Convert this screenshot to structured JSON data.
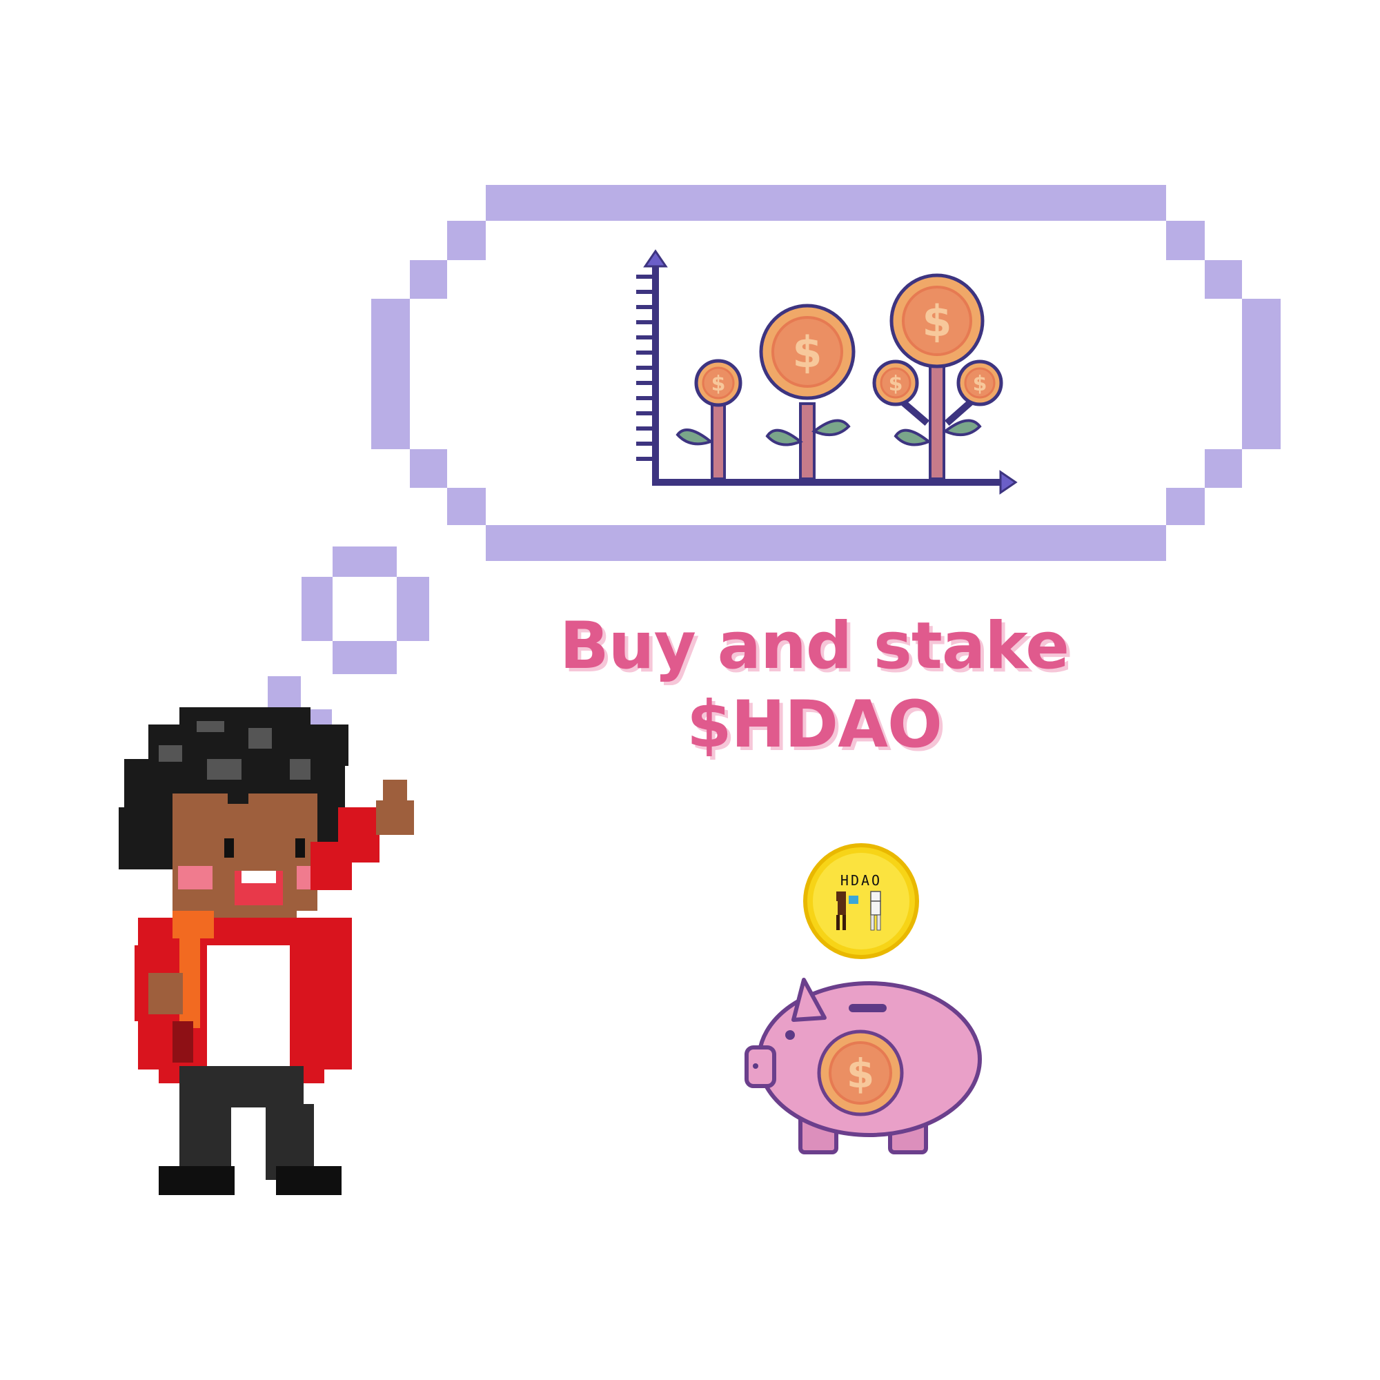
{
  "headline": {
    "line1": "Buy and stake",
    "line2": "$HDAO",
    "color": "#e05a8d"
  },
  "coin": {
    "text": "HDAO",
    "icon": "hdao-coin-icon"
  },
  "icons": {
    "bubble": "thought-bubble-icon",
    "growth": "money-tree-growth-chart-icon",
    "character": "pixel-boy-character",
    "piggy": "piggy-bank-icon"
  },
  "colors": {
    "bubble": "#b9aee6",
    "coin_orange": "#f0a868",
    "coin_yellow": "#f7d417",
    "piggy_pink": "#e9a0c8",
    "jacket_red": "#d9141e"
  }
}
